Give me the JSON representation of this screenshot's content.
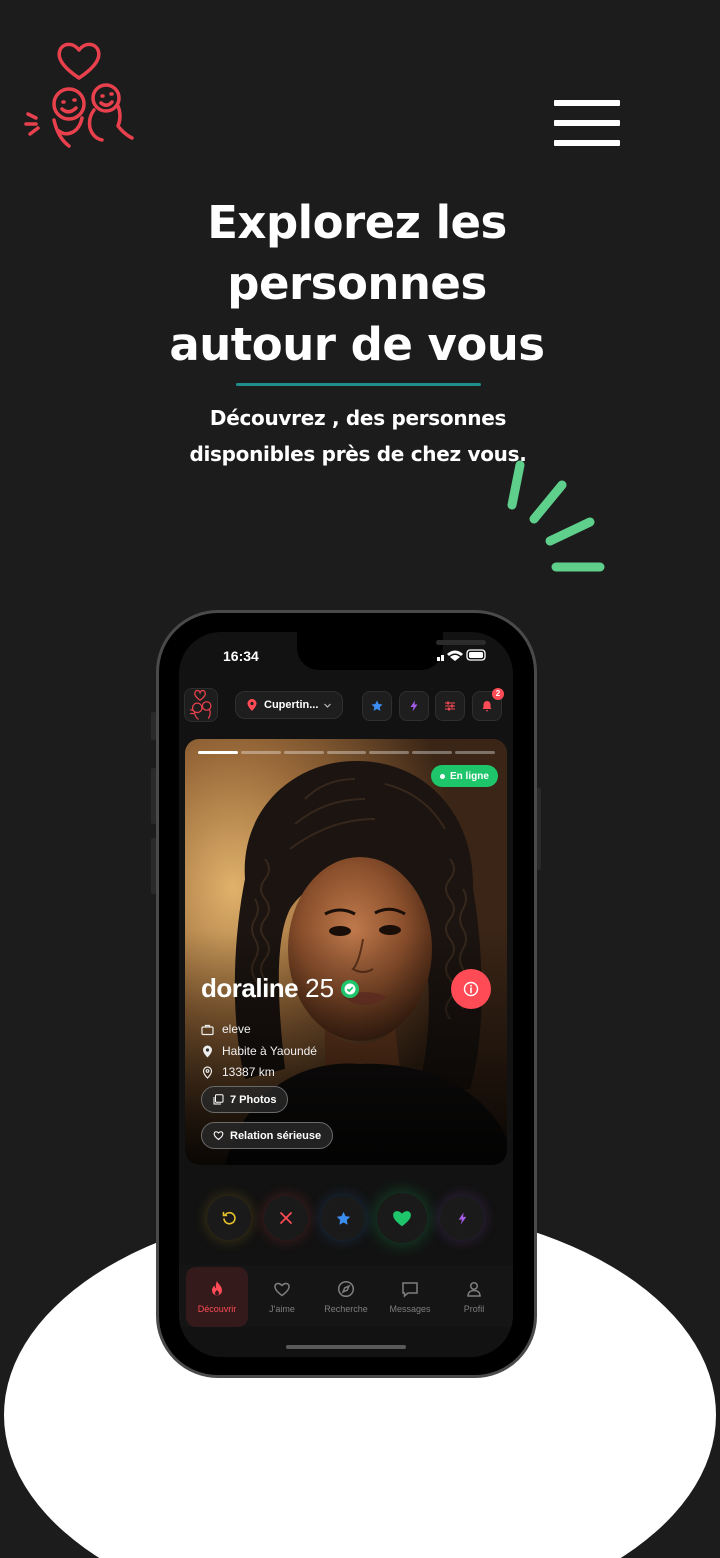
{
  "site": {
    "logo_icon": "couple-heart-logo-icon",
    "menu_icon": "hamburger-menu-icon",
    "accent_color": "#ff4b55",
    "divider_color": "#1f8e8e",
    "spark_color": "#5fd08c"
  },
  "hero": {
    "title_line1": "Explorez les",
    "title_line2": "personnes",
    "title_line3": "autour de vous",
    "subtitle_line1": "Découvrez , des personnes",
    "subtitle_line2": "disponibles près de chez vous."
  },
  "phone": {
    "status": {
      "time": "16:34"
    },
    "toolbar": {
      "location": "Cupertin...",
      "notification_count": "2"
    },
    "profile": {
      "photo_count": 7,
      "active_photo": 1,
      "online_label": "En ligne",
      "name": "doraline",
      "age": "25",
      "occupation": "eleve",
      "lives_in": "Habite à Yaoundé",
      "distance": "13387 km",
      "photos_label": "7 Photos",
      "relation_label": "Relation sérieuse"
    },
    "actions": [
      "rewind",
      "pass",
      "superlike",
      "like",
      "boost"
    ],
    "tabs": [
      {
        "label": "Découvrir",
        "icon": "flame-icon",
        "active": true
      },
      {
        "label": "J'aime",
        "icon": "heart-icon",
        "active": false
      },
      {
        "label": "Recherche",
        "icon": "compass-icon",
        "active": false
      },
      {
        "label": "Messages",
        "icon": "chat-icon",
        "active": false
      },
      {
        "label": "Profil",
        "icon": "user-icon",
        "active": false
      }
    ]
  }
}
